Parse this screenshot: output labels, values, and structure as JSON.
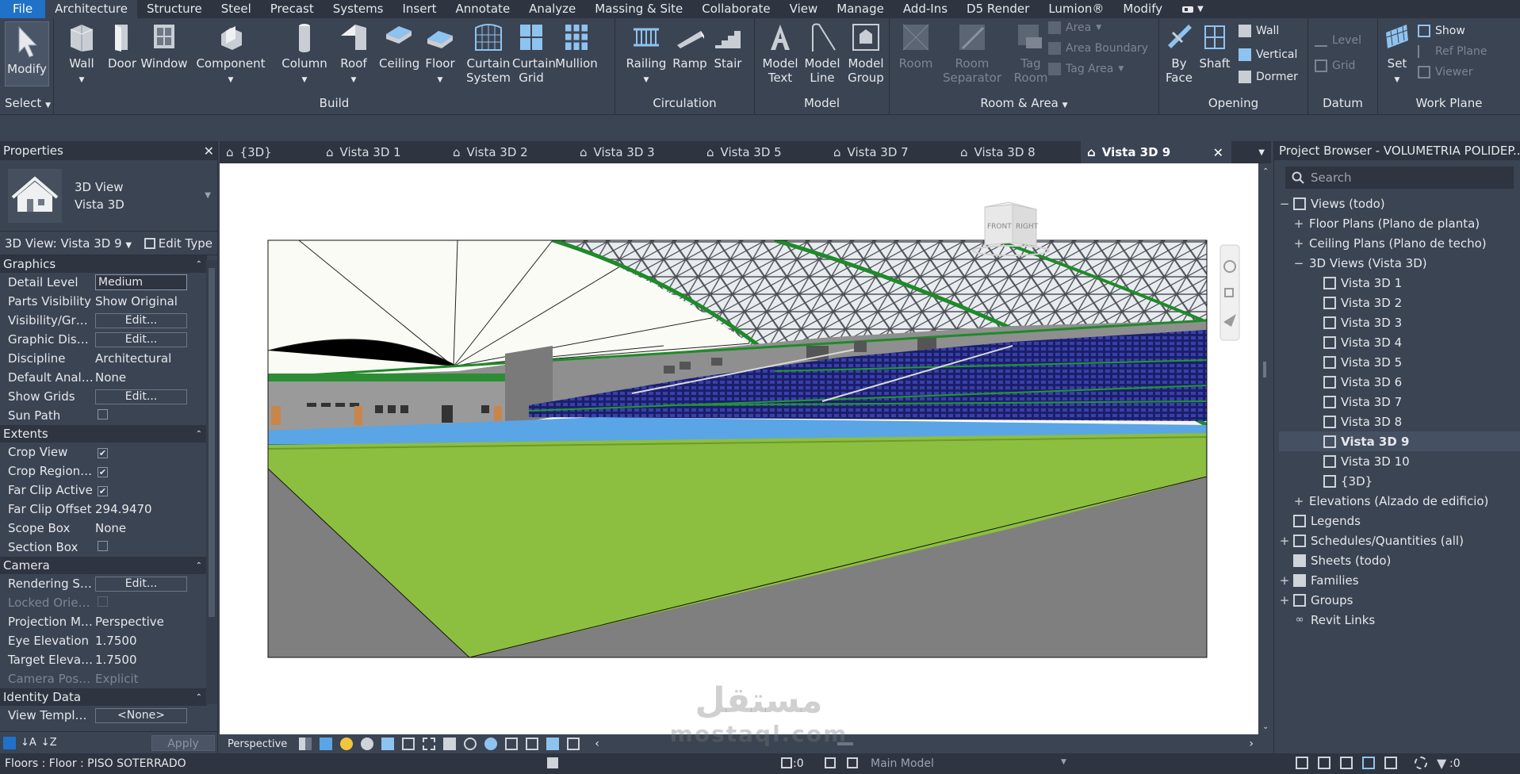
{
  "menu": {
    "file": "File",
    "tabs": [
      "Architecture",
      "Structure",
      "Steel",
      "Precast",
      "Systems",
      "Insert",
      "Annotate",
      "Analyze",
      "Massing & Site",
      "Collaborate",
      "View",
      "Manage",
      "Add-Ins",
      "D5 Render",
      "Lumion®",
      "Modify"
    ]
  },
  "ribbon": {
    "select": {
      "modify": "Modify",
      "title": "Select"
    },
    "build": {
      "title": "Build",
      "wall": "Wall",
      "door": "Door",
      "window": "Window",
      "component": "Component",
      "column": "Column",
      "roof": "Roof",
      "ceiling": "Ceiling",
      "floor": "Floor",
      "curtain_system": "Curtain System",
      "curtain_grid": "Curtain Grid",
      "mullion": "Mullion"
    },
    "circulation": {
      "title": "Circulation",
      "railing": "Railing",
      "ramp": "Ramp",
      "stair": "Stair"
    },
    "model": {
      "title": "Model",
      "model_text": "Model Text",
      "model_line": "Model Line",
      "model_group": "Model Group"
    },
    "room_area": {
      "title": "Room & Area",
      "room": "Room",
      "room_separator": "Room Separator",
      "tag_room": "Tag Room",
      "area": "Area",
      "area_boundary": "Area Boundary",
      "tag_area": "Tag Area"
    },
    "opening": {
      "title": "Opening",
      "by_face": "By Face",
      "shaft": "Shaft",
      "wall": "Wall",
      "vertical": "Vertical",
      "dormer": "Dormer"
    },
    "datum": {
      "title": "Datum",
      "level": "Level",
      "grid": "Grid"
    },
    "work_plane": {
      "title": "Work Plane",
      "set": "Set",
      "show": "Show",
      "ref_plane": "Ref Plane",
      "viewer": "Viewer"
    }
  },
  "properties": {
    "title": "Properties",
    "type_line1": "3D View",
    "type_line2": "Vista 3D",
    "selector": "3D View: Vista 3D 9",
    "edit_type": "Edit Type",
    "groups": {
      "graphics": "Graphics",
      "extents": "Extents",
      "camera": "Camera",
      "identity": "Identity Data"
    },
    "rows": {
      "detail_level": {
        "label": "Detail Level",
        "value": "Medium"
      },
      "parts_visibility": {
        "label": "Parts Visibility",
        "value": "Show Original"
      },
      "visibility_graphics": {
        "label": "Visibility/Grap...",
        "value": "Edit..."
      },
      "graphic_display": {
        "label": "Graphic Displ...",
        "value": "Edit..."
      },
      "discipline": {
        "label": "Discipline",
        "value": "Architectural"
      },
      "default_analysis": {
        "label": "Default Analys...",
        "value": "None"
      },
      "show_grids": {
        "label": "Show Grids",
        "value": "Edit..."
      },
      "sun_path": {
        "label": "Sun Path",
        "checked": false
      },
      "crop_view": {
        "label": "Crop View",
        "checked": true
      },
      "crop_region": {
        "label": "Crop Region V...",
        "checked": true
      },
      "far_clip_active": {
        "label": "Far Clip Active",
        "checked": true
      },
      "far_clip_offset": {
        "label": "Far Clip Offset",
        "value": "294.9470"
      },
      "scope_box": {
        "label": "Scope Box",
        "value": "None"
      },
      "section_box": {
        "label": "Section Box",
        "checked": false
      },
      "rendering_settings": {
        "label": "Rendering Set...",
        "value": "Edit..."
      },
      "locked_orientation": {
        "label": "Locked Orient...",
        "checked": false
      },
      "projection_mode": {
        "label": "Projection Mo...",
        "value": "Perspective"
      },
      "eye_elevation": {
        "label": "Eye Elevation",
        "value": "1.7500"
      },
      "target_elevation": {
        "label": "Target Elevati...",
        "value": "1.7500"
      },
      "camera_position": {
        "label": "Camera Positi...",
        "value": "Explicit"
      },
      "view_template": {
        "label": "View Template",
        "value": "<None>"
      }
    },
    "apply": "Apply"
  },
  "view_tabs": [
    "{3D}",
    "Vista 3D 1",
    "Vista 3D 2",
    "Vista 3D 3",
    "Vista 3D 5",
    "Vista 3D 7",
    "Vista 3D 8"
  ],
  "active_tab": "Vista 3D 9",
  "viewcube": {
    "front": "FRONT",
    "right": "RIGHT"
  },
  "view_control": {
    "mode": "Perspective"
  },
  "browser": {
    "title": "Project Browser - VOLUMETRIA POLIDEP...",
    "search_placeholder": "Search",
    "views_root": "Views (todo)",
    "floor_plans": "Floor Plans (Plano de planta)",
    "ceiling_plans": "Ceiling Plans (Plano de techo)",
    "views_3d": "3D Views (Vista 3D)",
    "views_3d_items": [
      "Vista 3D 1",
      "Vista 3D 2",
      "Vista 3D 3",
      "Vista 3D 4",
      "Vista 3D 5",
      "Vista 3D 6",
      "Vista 3D 7",
      "Vista 3D 8",
      "Vista 3D 9",
      "Vista 3D 10",
      "{3D}"
    ],
    "active_item": "Vista 3D 9",
    "elevations": "Elevations (Alzado de edificio)",
    "legends": "Legends",
    "schedules": "Schedules/Quantities (all)",
    "sheets": "Sheets (todo)",
    "families": "Families",
    "groups": "Groups",
    "revit_links": "Revit Links"
  },
  "status": {
    "text": "Floors : Floor : PISO SOTERRADO",
    "model": "Main Model",
    "count_left": ":0",
    "count_right": ":0"
  },
  "watermark": {
    "arabic": "مستقل",
    "latin": "mostaql.com"
  },
  "colors": {
    "accent": "#1f72c8",
    "panel": "#3b4453",
    "dark": "#2e3440",
    "field_green": "#8cbf3f",
    "track_blue": "#5aa5e6",
    "seat_blue": "#1e2580"
  }
}
